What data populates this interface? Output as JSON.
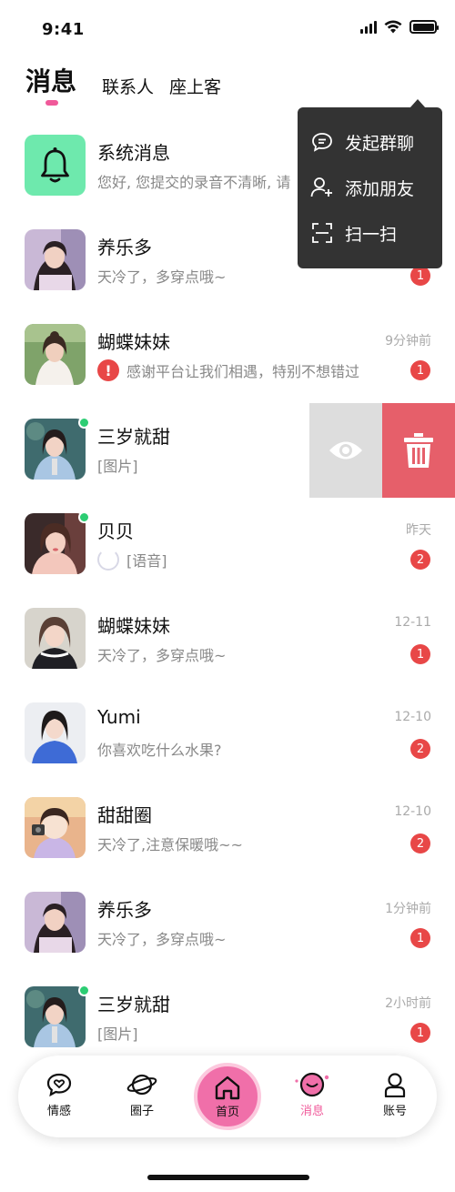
{
  "status_bar": {
    "time": "9:41"
  },
  "tabs": [
    {
      "label": "消息",
      "active": true
    },
    {
      "label": "联系人",
      "active": false
    },
    {
      "label": "座上客",
      "active": false
    }
  ],
  "popup_menu": {
    "items": [
      {
        "label": "发起群聊",
        "icon": "chat-bubble-icon"
      },
      {
        "label": "添加朋友",
        "icon": "add-user-icon"
      },
      {
        "label": "扫一扫",
        "icon": "scan-icon"
      }
    ]
  },
  "messages": [
    {
      "name": "系统消息",
      "preview": "您好, 您提交的录音不清晰, 请",
      "time": "",
      "badge": "",
      "avatar": "system-bell"
    },
    {
      "name": "养乐多",
      "preview": "天冷了，多穿点哦~",
      "time": "",
      "badge": "1",
      "avatar": "photo"
    },
    {
      "name": "蝴蝶妹妹",
      "preview": "感谢平台让我们相遇，特别不想错过",
      "time": "9分钟前",
      "badge": "1",
      "avatar": "photo",
      "preview_icon": "warning-icon"
    },
    {
      "name": "三岁就甜",
      "preview": "[图片]",
      "time": "",
      "badge": "",
      "avatar": "photo",
      "online": true
    },
    {
      "name": "贝贝",
      "preview": "[语音]",
      "time": "昨天",
      "badge": "2",
      "avatar": "photo",
      "online": true,
      "preview_icon": "voice-loading-icon"
    },
    {
      "name": "蝴蝶妹妹",
      "preview": "天冷了，多穿点哦~",
      "time": "12-11",
      "badge": "1",
      "avatar": "photo"
    },
    {
      "name": "Yumi",
      "preview": "你喜欢吃什么水果?",
      "time": "12-10",
      "badge": "2",
      "avatar": "photo"
    },
    {
      "name": "甜甜圈",
      "preview": "天冷了,注意保暖哦~~",
      "time": "12-10",
      "badge": "2",
      "avatar": "photo"
    },
    {
      "name": "养乐多",
      "preview": "天冷了，多穿点哦~",
      "time": "1分钟前",
      "badge": "1",
      "avatar": "photo"
    },
    {
      "name": "三岁就甜",
      "preview": "[图片]",
      "time": "2小时前",
      "badge": "1",
      "avatar": "photo",
      "online": true
    }
  ],
  "swipe_actions": {
    "view_icon": "eye-icon",
    "delete_icon": "trash-icon"
  },
  "bottom_nav": [
    {
      "label": "情感",
      "icon": "heart-chat-icon"
    },
    {
      "label": "圈子",
      "icon": "planet-icon"
    },
    {
      "label": "首页",
      "icon": "home-icon",
      "highlight": true
    },
    {
      "label": "消息",
      "icon": "message-icon",
      "active": true
    },
    {
      "label": "账号",
      "icon": "user-icon"
    }
  ],
  "colors": {
    "accent_pink": "#f0599a",
    "badge_red": "#e84747",
    "online_green": "#2ccd73",
    "delete_red": "#e65f6a",
    "menu_bg": "#333333"
  }
}
